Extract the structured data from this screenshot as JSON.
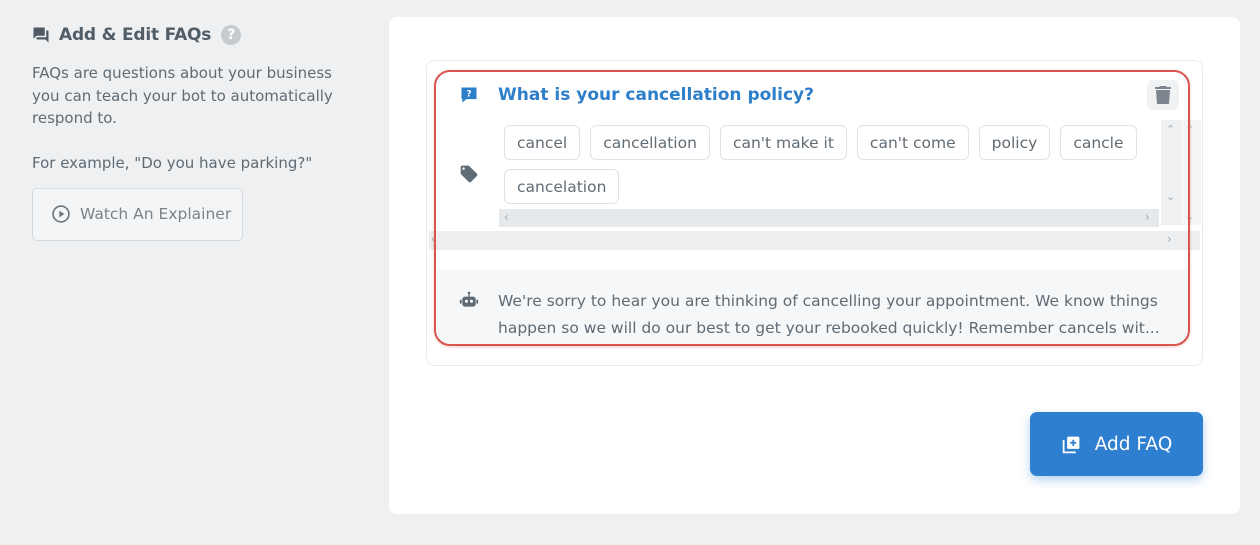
{
  "sidebar": {
    "title": "Add & Edit FAQs",
    "help_glyph": "?",
    "description": "FAQs are questions about your business you can teach your bot to automatically respond to.",
    "example": "For example, \"Do you have parking?\"",
    "explainer_label": "Watch An Explainer"
  },
  "faq": {
    "question": "What is your cancellation policy?",
    "tags": [
      "cancel",
      "cancellation",
      "can't make it",
      "can't come",
      "policy",
      "cancle",
      "cancelation"
    ],
    "answer": "We're sorry to hear you are thinking of cancelling your appointment. We know things happen so we will do our best to get your rebooked quickly! Remember cancels wit..."
  },
  "actions": {
    "add_faq_label": "Add FAQ"
  },
  "colors": {
    "accent": "#2e7fd0",
    "question": "#2e7fc9",
    "highlight": "#d9534f",
    "icon_gray": "#5f6b75"
  },
  "icons": [
    "chat-icon",
    "help-icon",
    "play-circle-icon",
    "question-bubble-icon",
    "trash-icon",
    "tag-icon",
    "robot-icon",
    "add-box-icon"
  ]
}
